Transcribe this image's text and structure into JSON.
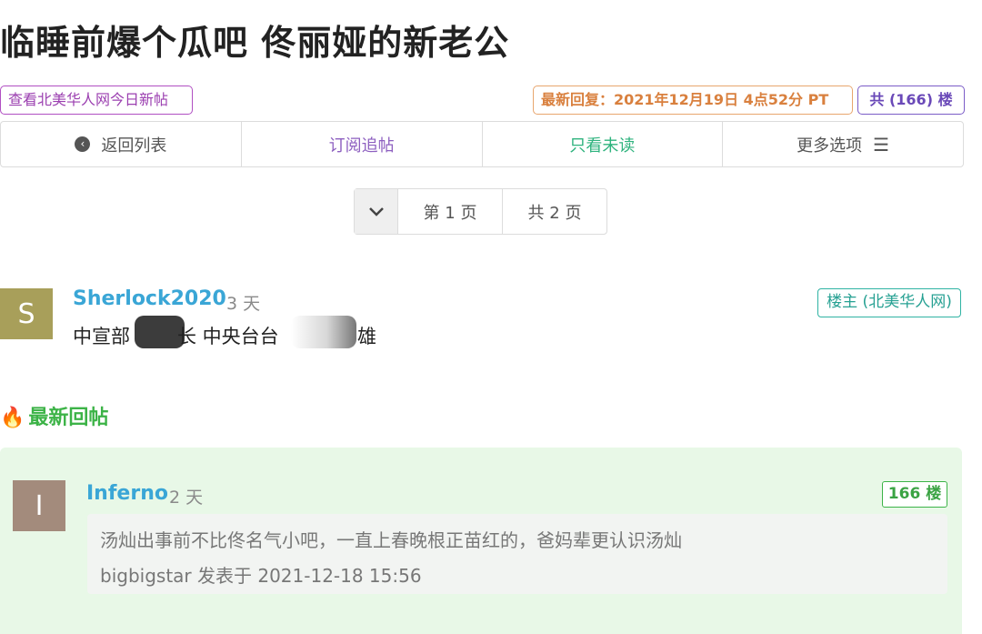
{
  "thread": {
    "title": "临睡前爆个瓜吧 佟丽娅的新老公",
    "today_posts_link": "查看北美华人网今日新帖",
    "latest_reply": "最新回复：2021年12月19日 4点52分 PT",
    "floor_count": "共 (166) 楼"
  },
  "toolbar": {
    "back_icon": "chevron-left-circle-icon",
    "back_label": "返回列表",
    "subscribe_label": "订阅追帖",
    "unread_label": "只看未读",
    "more_label": "更多选项",
    "more_icon": "hamburger-menu-icon"
  },
  "pager": {
    "current": "第 1 页",
    "total": "共 2 页"
  },
  "op_post": {
    "avatar_letter": "S",
    "username": "Sherlock2020",
    "time": "3 天",
    "text_part1": "中宣部",
    "text_part2": "长 中央台台",
    "text_part3": "雄",
    "badge": "楼主 (北美华人网)"
  },
  "latest_section": {
    "icon": "fire-icon",
    "title": "最新回帖"
  },
  "reply": {
    "avatar_letter": "I",
    "username": "Inferno",
    "time": "2 天",
    "floor": "166 楼",
    "quote_text": "汤灿出事前不比佟名气小吧，一直上春晚根正苗红的，爸妈辈更认识汤灿",
    "quote_meta": "bigbigstar 发表于 2021-12-18 15:56"
  },
  "colors": {
    "username": "#3aa6d6",
    "latest_green": "#3cb347",
    "reply_bg": "#e8f8e7",
    "latest_reply_orange": "#d9803e",
    "floor_purple": "#6a49b8",
    "today_purple": "#9b3fb0"
  }
}
